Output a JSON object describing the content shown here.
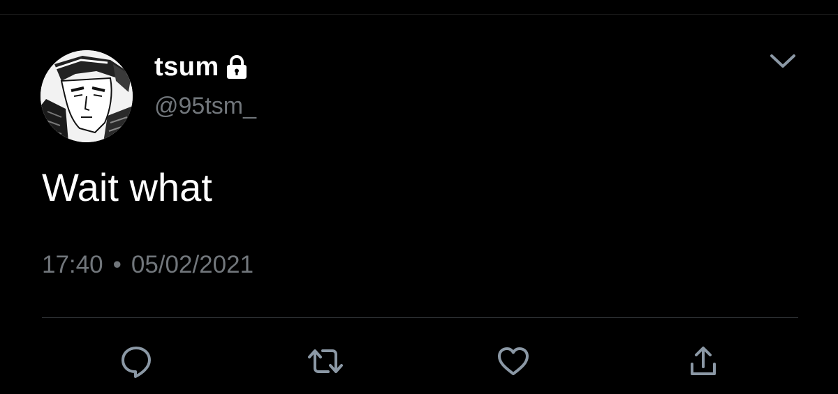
{
  "tweet": {
    "display_name": "tsum",
    "handle": "@95tsm_",
    "text": "Wait what",
    "time": "17:40",
    "separator": "•",
    "date": "05/02/2021",
    "protected_icon": "lock-icon",
    "avatar_icon": "manga-avatar"
  },
  "actions": {
    "reply_icon": "reply-icon",
    "retweet_icon": "retweet-icon",
    "like_icon": "heart-icon",
    "share_icon": "share-icon",
    "more_icon": "chevron-down-icon"
  },
  "colors": {
    "background": "#000000",
    "primary_text": "#ffffff",
    "secondary_text": "#71767b",
    "icon": "#8b98a5",
    "divider": "#2f3336"
  }
}
